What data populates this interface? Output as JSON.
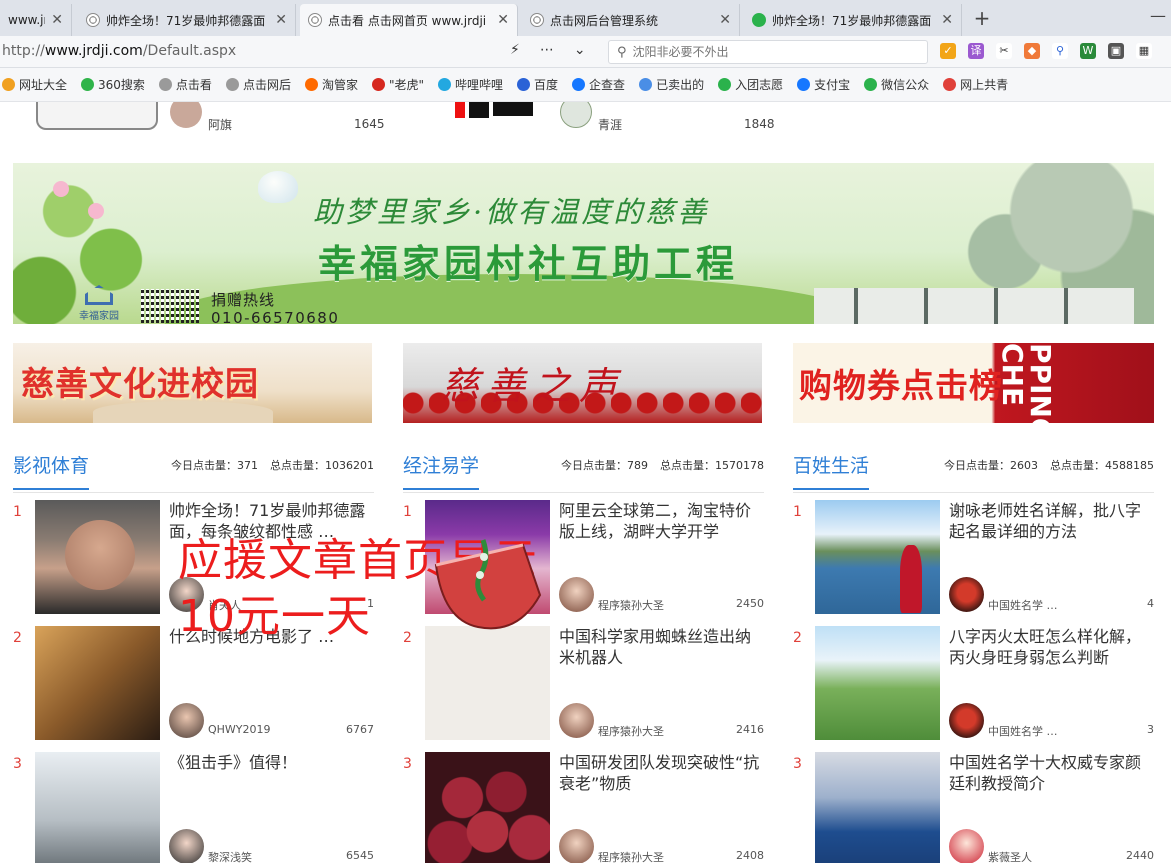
{
  "browser": {
    "tabs": [
      {
        "title": "www.jrdji.",
        "active": false
      },
      {
        "title": "帅炸全场！71岁最帅邦德露面",
        "active": false
      },
      {
        "title": "点击看 点击网首页 www.jrdji",
        "active": true
      },
      {
        "title": "点击网后台管理系统",
        "active": false
      },
      {
        "title": "帅炸全场！71岁最帅邦德露面",
        "active": false
      }
    ],
    "url_prefix": "http://",
    "url_host": "www.jrdji.com",
    "url_path": "/Default.aspx",
    "search_placeholder": "沈阳非必要不外出",
    "bookmarks": [
      {
        "label": "网址大全",
        "color": "#f0a020"
      },
      {
        "label": "360搜索",
        "color": "#2fb44a"
      },
      {
        "label": "点击看",
        "color": "#9a9a9a"
      },
      {
        "label": "点击网后",
        "color": "#9a9a9a"
      },
      {
        "label": "淘管家",
        "color": "#ff6a00"
      },
      {
        "label": "\"老虎\"",
        "color": "#d6281f"
      },
      {
        "label": "哔哩哔哩",
        "color": "#23a8e0"
      },
      {
        "label": "百度",
        "color": "#2a62d6"
      },
      {
        "label": "企查查",
        "color": "#1677ff"
      },
      {
        "label": "已卖出的",
        "color": "#4a8ee6"
      },
      {
        "label": "入团志愿",
        "color": "#2bb24c"
      },
      {
        "label": "支付宝",
        "color": "#1677ff"
      },
      {
        "label": "微信公众",
        "color": "#2bb24c"
      },
      {
        "label": "网上共青",
        "color": "#e0413a"
      }
    ]
  },
  "toprow": {
    "left_name": "阿旗",
    "left_count": "1645",
    "right_name": "青涯",
    "right_count": "1848"
  },
  "banner": {
    "slogan": "助梦里家乡·做有温度的慈善",
    "project": "幸福家园村社互助工程",
    "brand": "幸福家园",
    "hotline_label": "捐赠热线",
    "hotline": "010-66570680"
  },
  "sub_banners": [
    {
      "text": "慈善文化进校园"
    },
    {
      "text": "慈善之声"
    },
    {
      "text": "购物券点击榜",
      "side": "PPING CHE"
    }
  ],
  "columns": [
    {
      "title": "影视体育",
      "today": "今日点击量：371",
      "total": "总点击量：1036201",
      "items": [
        {
          "rank": "1",
          "title": "帅炸全场！71岁最帅邦德露面，每条皱纹都性感 …",
          "author": "肖夫人",
          "views": "1"
        },
        {
          "rank": "2",
          "title": "什么时候地方电影了 …",
          "author": "QHWY2019",
          "views": "6767"
        },
        {
          "rank": "3",
          "title": "《狙击手》值得！",
          "author": "黎深浅笑",
          "views": "6545"
        }
      ]
    },
    {
      "title": "经注易学",
      "today": "今日点击量：789",
      "total": "总点击量：1570178",
      "items": [
        {
          "rank": "1",
          "title": "阿里云全球第二，淘宝特价版上线，湖畔大学开学",
          "author": "程序猿孙大圣",
          "views": "2450"
        },
        {
          "rank": "2",
          "title": "中国科学家用蜘蛛丝造出纳米机器人",
          "author": "程序猿孙大圣",
          "views": "2416"
        },
        {
          "rank": "3",
          "title": "中国研发团队发现突破性“抗衰老”物质",
          "author": "程序猿孙大圣",
          "views": "2408"
        }
      ]
    },
    {
      "title": "百姓生活",
      "today": "今日点击量：2603",
      "total": "总点击量：4588185",
      "items": [
        {
          "rank": "1",
          "title": "谢咏老师姓名详解，批八字起名最详细的方法",
          "author": "中国姓名学 …",
          "views": "4"
        },
        {
          "rank": "2",
          "title": "八字丙火太旺怎么样化解，丙火身旺身弱怎么判断",
          "author": "中国姓名学 …",
          "views": "3"
        },
        {
          "rank": "3",
          "title": "中国姓名学十大权威专家颜廷利教授简介",
          "author": "紫薇圣人",
          "views": "2440"
        }
      ]
    }
  ],
  "overlay_ad": {
    "line1": "应援文章首页显示",
    "line2": "10元一天"
  }
}
